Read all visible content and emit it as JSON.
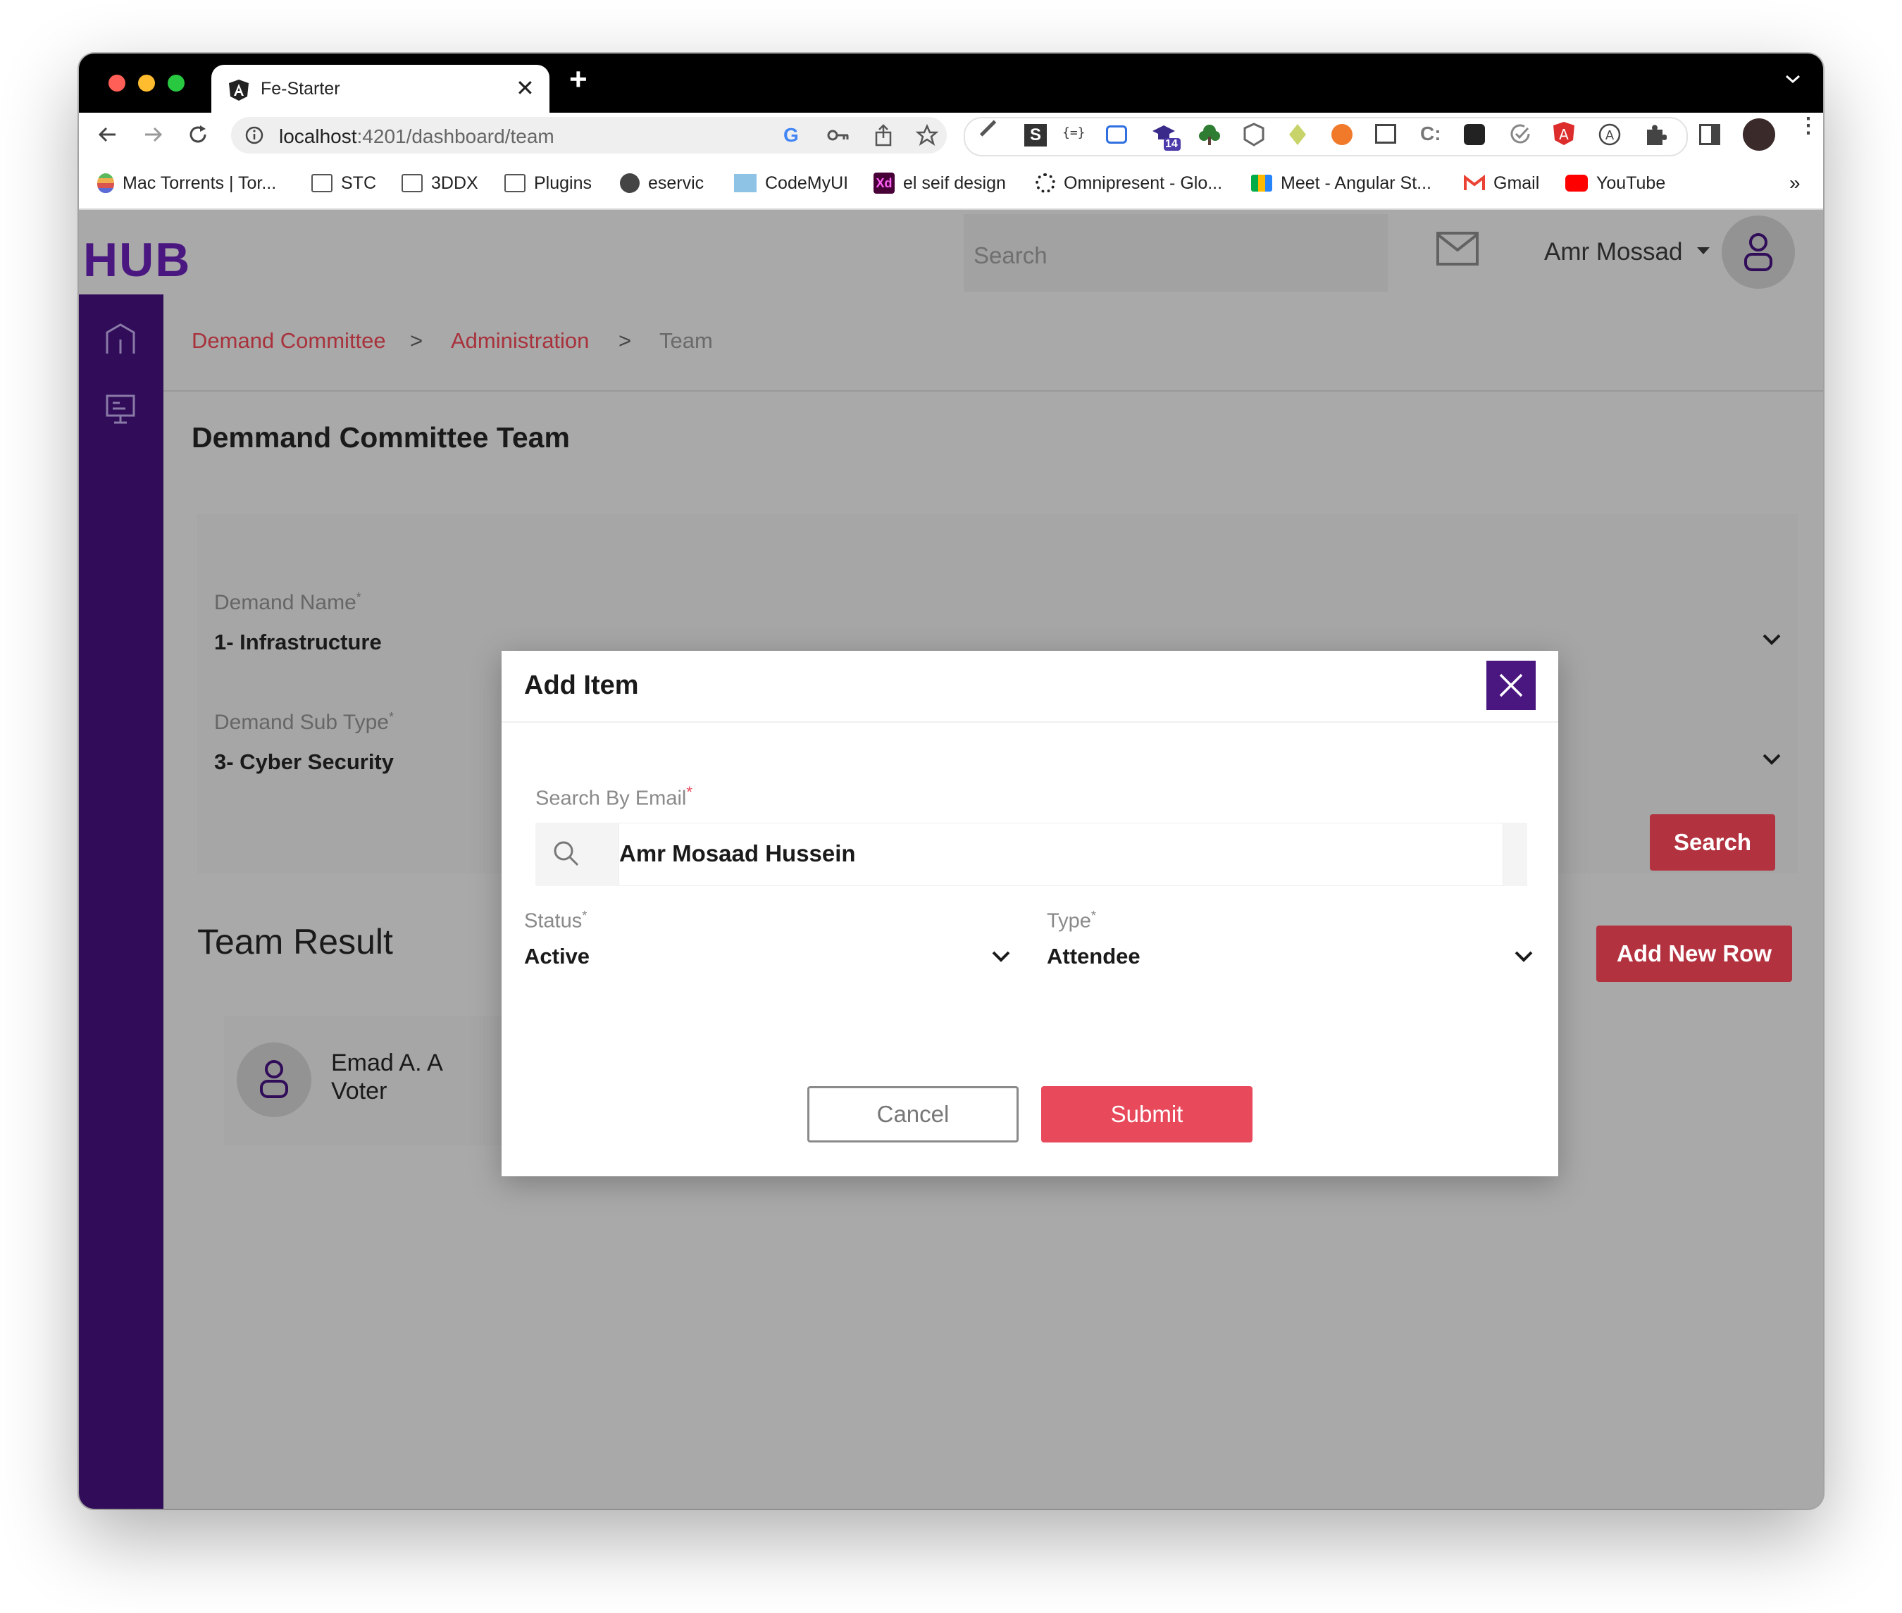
{
  "browser": {
    "tab_title": "Fe-Starter",
    "url_host": "localhost",
    "url_rest": ":4201/dashboard/team",
    "extension_badge": "14",
    "bookmarks": [
      {
        "label": "Mac Torrents | Tor...",
        "icon": "apple-icon"
      },
      {
        "label": "STC",
        "icon": "folder-icon"
      },
      {
        "label": "3DDX",
        "icon": "folder-icon"
      },
      {
        "label": "Plugins",
        "icon": "folder-icon"
      },
      {
        "label": "eservic",
        "icon": "globe-icon"
      },
      {
        "label": "CodeMyUI",
        "icon": "codemyui-icon"
      },
      {
        "label": "el seif design",
        "icon": "xd-icon"
      },
      {
        "label": "Omnipresent - Glo...",
        "icon": "omnipresent-icon"
      },
      {
        "label": "Meet - Angular St...",
        "icon": "meet-icon"
      },
      {
        "label": "Gmail",
        "icon": "gmail-icon"
      },
      {
        "label": "YouTube",
        "icon": "youtube-icon"
      }
    ],
    "more_bookmarks": "»"
  },
  "header": {
    "logo": "HUB",
    "search_placeholder": "Search",
    "user_name": "Amr Mossad"
  },
  "breadcrumb": {
    "items": [
      "Demand Committee",
      "Administration",
      "Team"
    ],
    "separator": ">"
  },
  "page": {
    "title": "Demmand Committee Team",
    "filters": {
      "demand_name_label": "Demand Name",
      "demand_name_value": "1- Infrastructure",
      "sub_type_label": "Demand Sub Type",
      "sub_type_value": "3- Cyber Security",
      "required_mark": "*"
    },
    "search_button": "Search",
    "results_title": "Team Result",
    "add_row_button": "Add New Row",
    "member": {
      "name": "Emad A. A",
      "role": "Voter"
    }
  },
  "modal": {
    "title": "Add Item",
    "email_label": "Search By Email",
    "required_mark": "*",
    "email_value": "Amr Mosaad Hussein",
    "status_label": "Status",
    "status_value": "Active",
    "type_label": "Type",
    "type_value": "Attendee",
    "cancel": "Cancel",
    "submit": "Submit"
  },
  "colors": {
    "sidebar": "#300c59",
    "brand_purple": "#4a1780",
    "breadcrumb_red": "#a8323c",
    "submit_red": "#e8495b",
    "overlay_gray": "#a9a9a9"
  }
}
